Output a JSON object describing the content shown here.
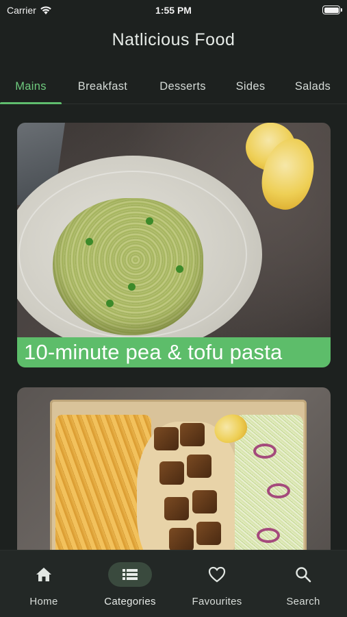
{
  "status_bar": {
    "carrier": "Carrier",
    "time": "1:55 PM",
    "battery_level": 1.0
  },
  "app": {
    "title": "Natlicious Food"
  },
  "tabs": [
    {
      "label": "Mains",
      "active": true
    },
    {
      "label": "Breakfast",
      "active": false
    },
    {
      "label": "Desserts",
      "active": false
    },
    {
      "label": "Sides",
      "active": false
    },
    {
      "label": "Salads",
      "active": false
    }
  ],
  "recipes": [
    {
      "title": "10-minute pea & tofu pasta",
      "image": "pea-tofu-pasta-photo"
    },
    {
      "title": "",
      "image": "tofu-kebab-fries-tray-photo"
    }
  ],
  "bottom_nav": [
    {
      "label": "Home",
      "icon": "home-icon",
      "active": false
    },
    {
      "label": "Categories",
      "icon": "list-icon",
      "active": true
    },
    {
      "label": "Favourites",
      "icon": "heart-icon",
      "active": false
    },
    {
      "label": "Search",
      "icon": "search-icon",
      "active": false
    }
  ],
  "colors": {
    "background": "#1d211f",
    "accent": "#5dbd6a",
    "active_tab_text": "#6fcb7e",
    "nav_active_pill": "#3a4a3e"
  }
}
